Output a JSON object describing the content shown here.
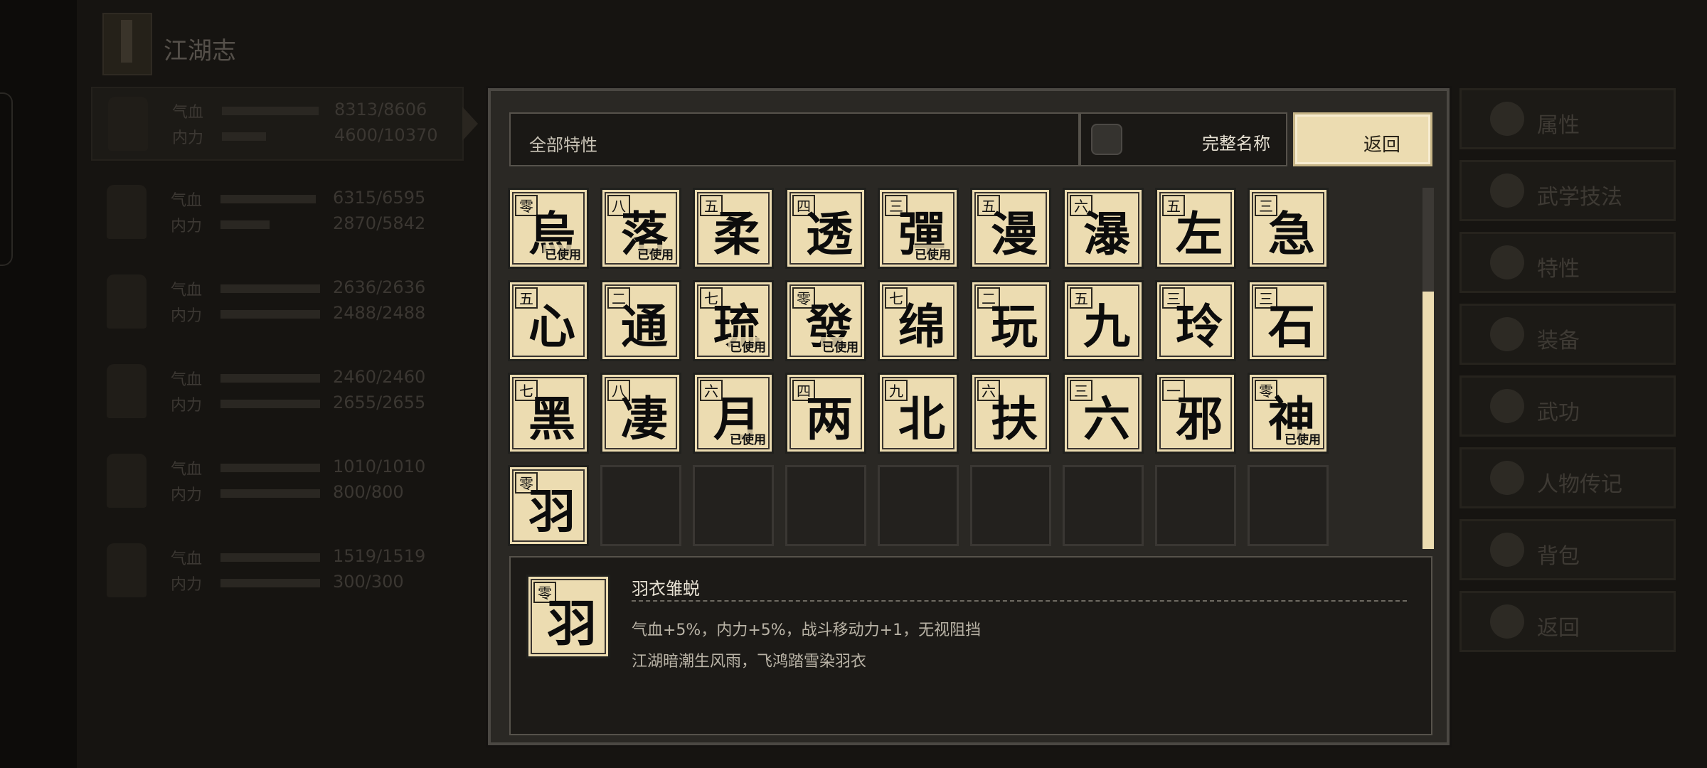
{
  "header": {
    "title": "江湖志"
  },
  "party": [
    {
      "hp_label": "气血",
      "hp": "8313/8606",
      "hp_fill": 0.97,
      "mp_label": "内力",
      "mp": "4600/10370",
      "mp_fill": 0.44
    },
    {
      "hp_label": "气血",
      "hp": "6315/6595",
      "hp_fill": 0.96,
      "mp_label": "内力",
      "mp": "2870/5842",
      "mp_fill": 0.49
    },
    {
      "hp_label": "气血",
      "hp": "2636/2636",
      "hp_fill": 1.0,
      "mp_label": "内力",
      "mp": "2488/2488",
      "mp_fill": 1.0
    },
    {
      "hp_label": "气血",
      "hp": "2460/2460",
      "hp_fill": 1.0,
      "mp_label": "内力",
      "mp": "2655/2655",
      "mp_fill": 1.0
    },
    {
      "hp_label": "气血",
      "hp": "1010/1010",
      "hp_fill": 1.0,
      "mp_label": "内力",
      "mp": "800/800",
      "mp_fill": 1.0
    },
    {
      "hp_label": "气血",
      "hp": "1519/1519",
      "hp_fill": 1.0,
      "mp_label": "内力",
      "mp": "300/300",
      "mp_fill": 1.0
    }
  ],
  "menu": [
    "属性",
    "武学技法",
    "特性",
    "装备",
    "武功",
    "人物传记",
    "背包",
    "返回"
  ],
  "modal": {
    "filter_label": "全部特性",
    "full_name_label": "完整名称",
    "return_label": "返回",
    "used_label": "已使用"
  },
  "traits": [
    {
      "rank": "零",
      "glyph": "烏",
      "used": true
    },
    {
      "rank": "八",
      "glyph": "落",
      "used": true
    },
    {
      "rank": "五",
      "glyph": "柔",
      "used": false
    },
    {
      "rank": "四",
      "glyph": "透",
      "used": false
    },
    {
      "rank": "三",
      "glyph": "彈",
      "used": true
    },
    {
      "rank": "五",
      "glyph": "漫",
      "used": false
    },
    {
      "rank": "六",
      "glyph": "瀑",
      "used": false
    },
    {
      "rank": "五",
      "glyph": "左",
      "used": false
    },
    {
      "rank": "三",
      "glyph": "急",
      "used": false
    },
    {
      "rank": "五",
      "glyph": "心",
      "used": false
    },
    {
      "rank": "二",
      "glyph": "通",
      "used": false
    },
    {
      "rank": "七",
      "glyph": "琉",
      "used": true
    },
    {
      "rank": "零",
      "glyph": "發",
      "used": true
    },
    {
      "rank": "七",
      "glyph": "绵",
      "used": false
    },
    {
      "rank": "二",
      "glyph": "玩",
      "used": false
    },
    {
      "rank": "五",
      "glyph": "九",
      "used": false
    },
    {
      "rank": "三",
      "glyph": "玲",
      "used": false
    },
    {
      "rank": "三",
      "glyph": "石",
      "used": false
    },
    {
      "rank": "七",
      "glyph": "黑",
      "used": false
    },
    {
      "rank": "八",
      "glyph": "凄",
      "used": false
    },
    {
      "rank": "六",
      "glyph": "月",
      "used": true
    },
    {
      "rank": "四",
      "glyph": "两",
      "used": false
    },
    {
      "rank": "九",
      "glyph": "北",
      "used": false
    },
    {
      "rank": "六",
      "glyph": "扶",
      "used": false
    },
    {
      "rank": "三",
      "glyph": "六",
      "used": false
    },
    {
      "rank": "一",
      "glyph": "邪",
      "used": false
    },
    {
      "rank": "零",
      "glyph": "神",
      "used": true
    },
    {
      "rank": "零",
      "glyph": "羽",
      "used": false
    }
  ],
  "detail": {
    "rank": "零",
    "glyph": "羽",
    "name": "羽衣雏蜕",
    "effect": "气血+5%，内力+5%，战斗移动力+1，无视阻挡",
    "flavor": "江湖暗潮生风雨，飞鸿踏雪染羽衣"
  }
}
